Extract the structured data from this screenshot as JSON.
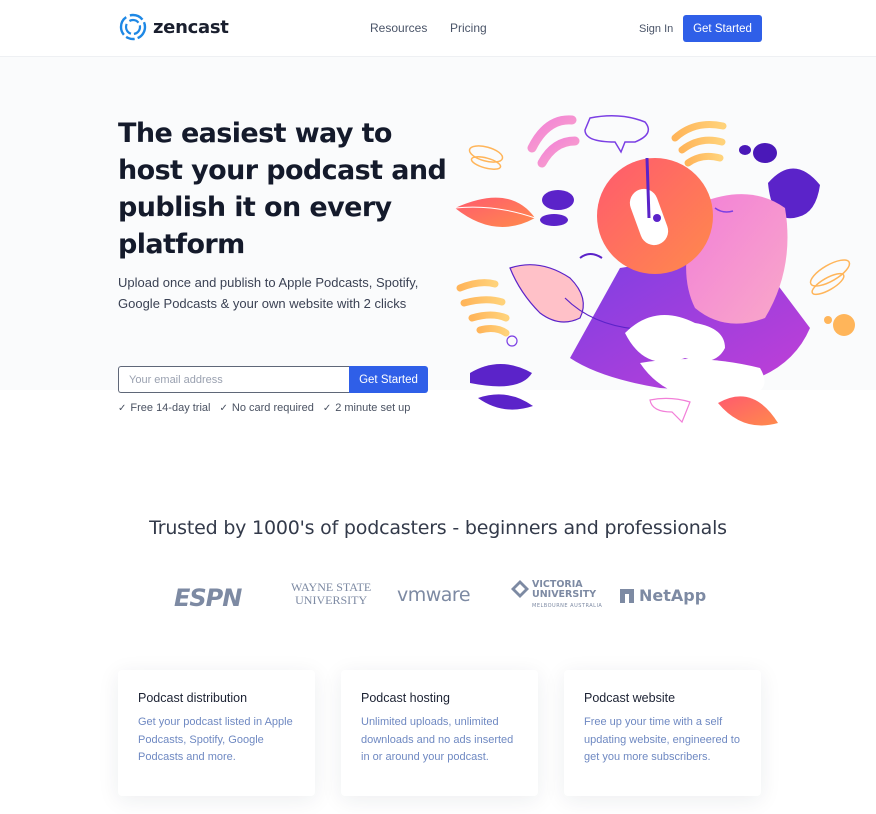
{
  "nav": {
    "brand": "zencast",
    "links": [
      "Resources",
      "Pricing"
    ],
    "sign_in": "Sign In",
    "cta": "Get Started"
  },
  "hero": {
    "title": "The easiest way to host your podcast and publish it on every platform",
    "subtitle": "Upload once and publish to Apple Podcasts, Spotify, Google Podcasts & your own website with 2 clicks",
    "email_placeholder": "Your email address",
    "cta": "Get Started",
    "perks": [
      "Free 14-day trial",
      "No card required",
      "2 minute set up"
    ]
  },
  "trust": {
    "heading": "Trusted by 1000's of podcasters - beginners and professionals",
    "logos": {
      "espn": "ESPN",
      "wayne_line1": "WAYNE STATE",
      "wayne_line2": "UNIVERSITY",
      "vmware": "vmware",
      "victoria_line1": "VICTORIA",
      "victoria_line2": "UNIVERSITY",
      "victoria_line3": "MELBOURNE AUSTRALIA",
      "netapp": "NetApp"
    }
  },
  "features": [
    {
      "title": "Podcast distribution",
      "text": "Get your podcast listed in Apple Podcasts, Spotify, Google Podcasts and more."
    },
    {
      "title": "Podcast hosting",
      "text": "Unlimited uploads, unlimited downloads and no ads inserted in or around your podcast."
    },
    {
      "title": "Podcast website",
      "text": "Free up your time with a self updating website, engineered to get you more subscribers."
    }
  ],
  "colors": {
    "accent": "#2f5fe8",
    "heading": "#141a2b",
    "card_text": "#6f89c2",
    "logo_gray": "#7d8aa3"
  }
}
